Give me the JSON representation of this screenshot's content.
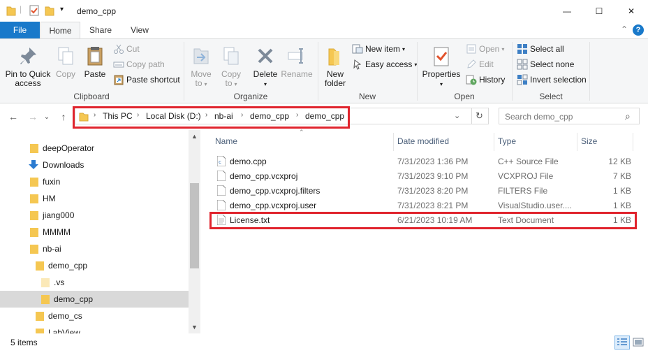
{
  "window": {
    "title": "demo_cpp",
    "minimize_glyph": "—",
    "maximize_glyph": "☐",
    "close_glyph": "✕",
    "qat_caret": "▾"
  },
  "ribbon_tabs": [
    {
      "label": "File"
    },
    {
      "label": "Home"
    },
    {
      "label": "Share"
    },
    {
      "label": "View"
    }
  ],
  "ribbon_right": {
    "collapse_glyph": "⌃",
    "help_glyph": "?"
  },
  "ribbon": {
    "clipboard": {
      "group": "Clipboard",
      "pin_line1": "Pin to Quick",
      "pin_line2": "access",
      "copy": "Copy",
      "paste": "Paste",
      "cut": "Cut",
      "copy_path": "Copy path",
      "paste_shortcut": "Paste shortcut"
    },
    "organize": {
      "group": "Organize",
      "move_to": "Move",
      "move_to2": "to",
      "copy_to": "Copy",
      "copy_to2": "to",
      "delete": "Delete",
      "rename": "Rename"
    },
    "new": {
      "group": "New",
      "new_folder1": "New",
      "new_folder2": "folder",
      "new_item": "New item",
      "easy_access": "Easy access"
    },
    "open": {
      "group": "Open",
      "properties": "Properties",
      "open": "Open",
      "edit": "Edit",
      "history": "History"
    },
    "select": {
      "group": "Select",
      "select_all": "Select all",
      "select_none": "Select none",
      "invert": "Invert selection"
    }
  },
  "nav_glyphs": {
    "back": "←",
    "forward": "→",
    "recent": "⌄",
    "up": "↑",
    "chev": "›",
    "dropdown": "⌄",
    "refresh": "↻",
    "search": "⌕"
  },
  "breadcrumb": [
    "This PC",
    "Local Disk (D:)",
    "nb-ai",
    "demo_cpp",
    "demo_cpp"
  ],
  "search": {
    "placeholder": "Search demo_cpp"
  },
  "nav_pane": [
    {
      "label": "deepOperator"
    },
    {
      "label": "Downloads"
    },
    {
      "label": "fuxin"
    },
    {
      "label": "HM"
    },
    {
      "label": "jiang000"
    },
    {
      "label": "MMMM"
    },
    {
      "label": "nb-ai"
    },
    {
      "label": "demo_cpp"
    },
    {
      "label": ".vs"
    },
    {
      "label": "demo_cpp"
    },
    {
      "label": "demo_cs"
    },
    {
      "label": "LabView"
    }
  ],
  "columns": {
    "name": "Name",
    "date": "Date modified",
    "type": "Type",
    "size": "Size"
  },
  "files": [
    {
      "name": "demo.cpp",
      "date": "7/31/2023 1:36 PM",
      "type": "C++ Source File",
      "size": "12 KB"
    },
    {
      "name": "demo_cpp.vcxproj",
      "date": "7/31/2023 9:10 PM",
      "type": "VCXPROJ File",
      "size": "7 KB"
    },
    {
      "name": "demo_cpp.vcxproj.filters",
      "date": "7/31/2023 8:20 PM",
      "type": "FILTERS File",
      "size": "1 KB"
    },
    {
      "name": "demo_cpp.vcxproj.user",
      "date": "7/31/2023 8:21 PM",
      "type": "VisualStudio.user....",
      "size": "1 KB"
    },
    {
      "name": "License.txt",
      "date": "6/21/2023 10:19 AM",
      "type": "Text Document",
      "size": "1 KB"
    }
  ],
  "status": {
    "items": "5 items"
  },
  "colors": {
    "accent": "#1979ca",
    "highlight": "#e0242d",
    "folder": "#f5c752"
  }
}
